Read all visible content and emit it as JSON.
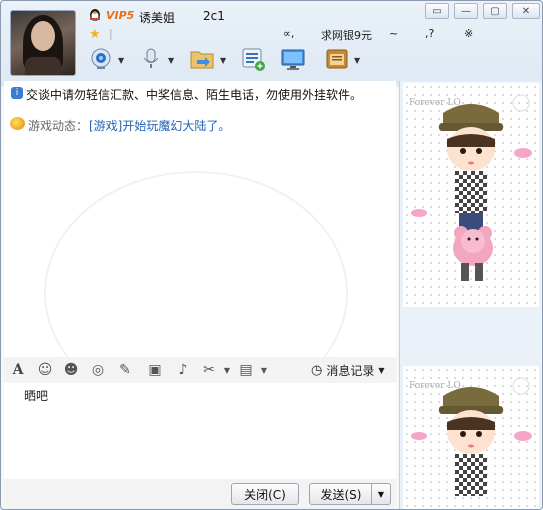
{
  "header": {
    "vip_badge": "VIP5",
    "nickname": "诱美姐",
    "nickname_suffix": "2c1",
    "signature_parts": [
      "∝,",
      "求网银9元",
      "~",
      ",?",
      "※"
    ]
  },
  "system": {
    "warning": "交谈中请勿轻信汇款、中奖信息、陌生电话，勿使用外挂软件。"
  },
  "game": {
    "label": "游戏动态：",
    "link": "[游戏]开始玩魔幻大陆了。"
  },
  "format_bar": {
    "font_glyph": "A",
    "history_label": "消息记录"
  },
  "input": {
    "text": "晒吧"
  },
  "buttons": {
    "close": "关闭(C)",
    "send": "发送(S)"
  },
  "sidebar": {
    "show_text": "Forever LO"
  },
  "colors": {
    "vip": "#e6711a",
    "link": "#1e63b6",
    "frame": "#8a9bb0"
  }
}
